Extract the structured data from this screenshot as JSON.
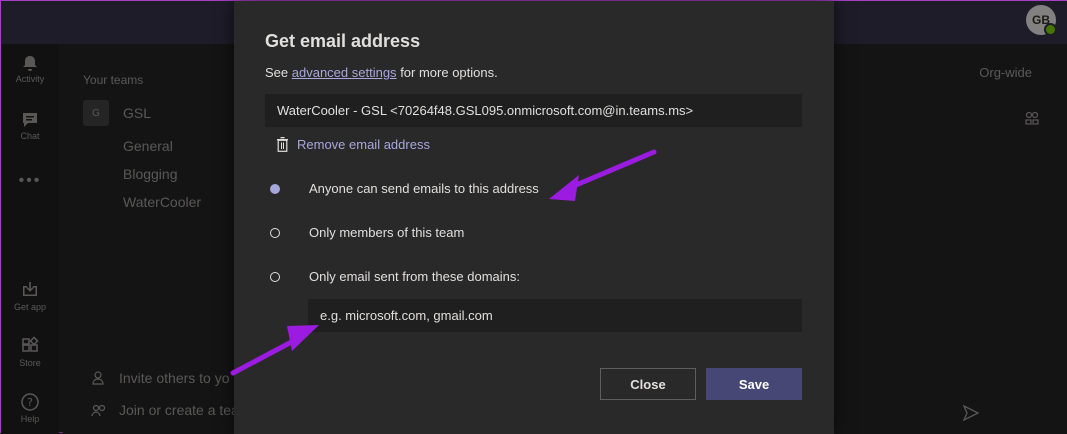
{
  "avatar": {
    "initials": "GB"
  },
  "rail": [
    {
      "label": "Activity",
      "icon": "bell-icon"
    },
    {
      "label": "Chat",
      "icon": "chat-icon"
    },
    {
      "label": "Get app",
      "icon": "download-icon"
    },
    {
      "label": "Store",
      "icon": "store-icon"
    },
    {
      "label": "Help",
      "icon": "help-icon"
    }
  ],
  "teams": {
    "header": "Your teams",
    "team_name": "GSL",
    "team_initial": "G",
    "channels": [
      "General",
      "Blogging",
      "WaterCooler"
    ],
    "invite_label": "Invite others to yo",
    "join_label": "Join or create a tea"
  },
  "main": {
    "org_wide": "Org-wide"
  },
  "dialog": {
    "title": "Get email address",
    "sub_prefix": "See",
    "sub_link": "advanced settings",
    "sub_suffix": "for more options.",
    "address": "WaterCooler - GSL <70264f48.GSL095.onmicrosoft.com@in.teams.ms>",
    "remove_label": "Remove email address",
    "options": [
      {
        "label": "Anyone can send emails to this address",
        "selected": true
      },
      {
        "label": "Only members of this team",
        "selected": false
      },
      {
        "label": "Only email sent from these domains:",
        "selected": false
      }
    ],
    "domain_placeholder": "e.g. microsoft.com, gmail.com",
    "close_label": "Close",
    "save_label": "Save"
  },
  "colors": {
    "accent": "#a6a7dc",
    "annotation_arrow": "#9b1ce0",
    "save_button": "#464775"
  }
}
